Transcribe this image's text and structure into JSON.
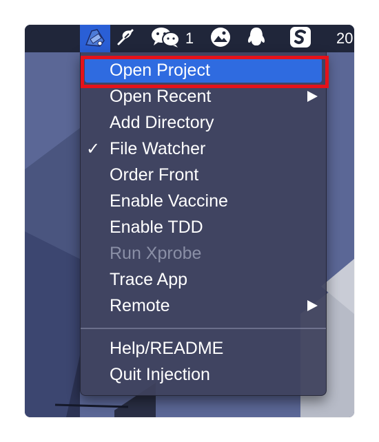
{
  "menubar": {
    "badge_count": "1",
    "clock_fragment": "20",
    "icons": [
      "injection-app-icon",
      "feather-icon",
      "wechat-icon",
      "photo-icon",
      "qq-penguin-icon",
      "sogou-input-icon"
    ]
  },
  "menu": {
    "items": [
      {
        "label": "Open Project",
        "state": "highlighted"
      },
      {
        "label": "Open Recent",
        "submenu": true
      },
      {
        "label": "Add Directory"
      },
      {
        "label": "File Watcher",
        "checked": true,
        "check_glyph": "✓"
      },
      {
        "label": "Order Front"
      },
      {
        "label": "Enable Vaccine"
      },
      {
        "label": "Enable TDD"
      },
      {
        "label": "Run Xprobe",
        "disabled": true
      },
      {
        "label": "Trace App"
      },
      {
        "label": "Remote",
        "submenu": true
      },
      {
        "label": "Help/README"
      },
      {
        "label": "Quit Injection"
      }
    ]
  },
  "annotation": {
    "color": "#e5121a",
    "target": "Open Project"
  },
  "colors": {
    "menubar_bg": "#20263a",
    "highlight": "#2f6be0",
    "disabled_text": "#8a8fa6"
  }
}
